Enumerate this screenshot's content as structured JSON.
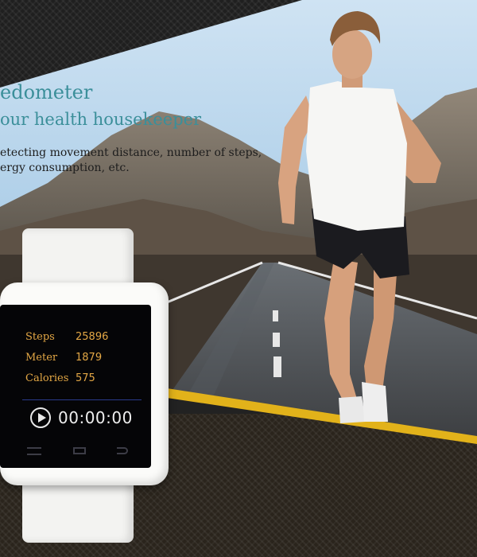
{
  "banner": {
    "headline": "edometer",
    "subline": "our health housekeeper",
    "description_lines": [
      "etecting movement distance, number of steps,",
      "ergy consumption, etc."
    ]
  },
  "watch": {
    "stats": [
      {
        "label": "Steps",
        "value": "25896"
      },
      {
        "label": "Meter",
        "value": "1879"
      },
      {
        "label": "Calories",
        "value": "575"
      }
    ],
    "timer": "00:00:00",
    "icons": [
      "play-icon",
      "menu-icon",
      "home-icon",
      "back-icon"
    ]
  },
  "colors": {
    "headline": "#3b8f9a",
    "stat_text": "#e3a745",
    "road_stripe": "#e2b21a",
    "watch_body": "#fbfbf9"
  }
}
